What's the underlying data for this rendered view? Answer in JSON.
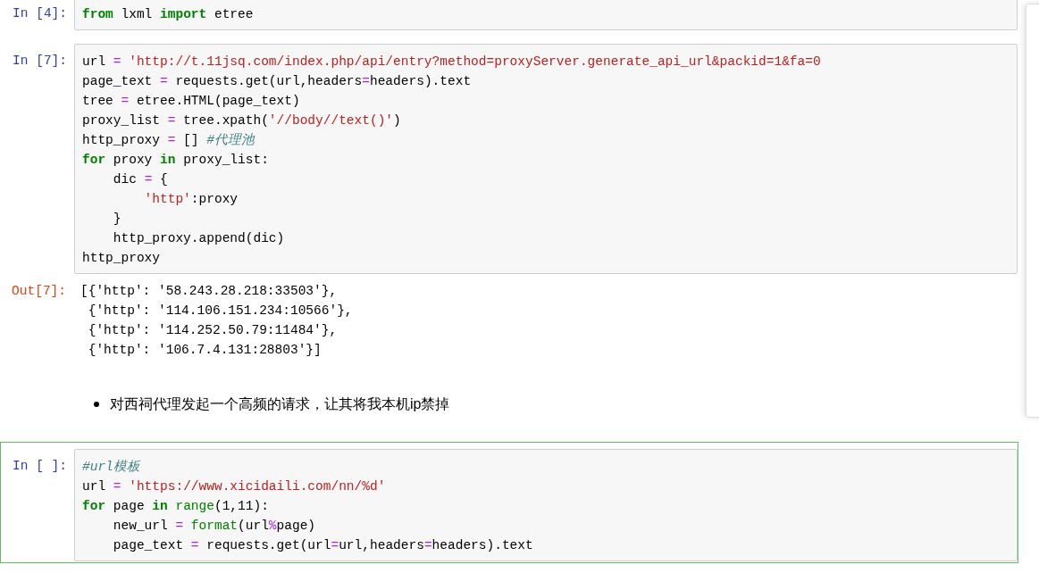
{
  "side_panel": {
    "shown": true
  },
  "cells": [
    {
      "kind": "code",
      "prompt": "In [4]:",
      "selected": false,
      "lines": [
        [
          {
            "kind": "kw",
            "text": "from"
          },
          {
            "kind": "tx",
            "text": " lxml "
          },
          {
            "kind": "kw",
            "text": "import"
          },
          {
            "kind": "tx",
            "text": " etree"
          }
        ]
      ]
    },
    {
      "kind": "code",
      "prompt": "In [7]:",
      "selected": false,
      "lines": [
        [
          {
            "kind": "tx",
            "text": "url "
          },
          {
            "kind": "op",
            "text": "="
          },
          {
            "kind": "str",
            "text": " 'http://t.11jsq.com/index.php/api/entry?method=proxyServer.generate_api_url&packid=1&fa=0"
          }
        ],
        [
          {
            "kind": "tx",
            "text": "page_text "
          },
          {
            "kind": "op",
            "text": "="
          },
          {
            "kind": "tx",
            "text": " requests.get(url,headers"
          },
          {
            "kind": "op",
            "text": "="
          },
          {
            "kind": "tx",
            "text": "headers).text"
          }
        ],
        [
          {
            "kind": "tx",
            "text": "tree "
          },
          {
            "kind": "op",
            "text": "="
          },
          {
            "kind": "tx",
            "text": " etree.HTML(page_text)"
          }
        ],
        [
          {
            "kind": "tx",
            "text": "proxy_list "
          },
          {
            "kind": "op",
            "text": "="
          },
          {
            "kind": "tx",
            "text": " tree.xpath("
          },
          {
            "kind": "str",
            "text": "'//body//text()'"
          },
          {
            "kind": "tx",
            "text": ")"
          }
        ],
        [
          {
            "kind": "tx",
            "text": "http_proxy "
          },
          {
            "kind": "op",
            "text": "="
          },
          {
            "kind": "tx",
            "text": " [] "
          },
          {
            "kind": "cm",
            "text": "#代理池"
          }
        ],
        [
          {
            "kind": "kw",
            "text": "for"
          },
          {
            "kind": "tx",
            "text": " proxy "
          },
          {
            "kind": "kw",
            "text": "in"
          },
          {
            "kind": "tx",
            "text": " proxy_list:"
          }
        ],
        [
          {
            "kind": "tx",
            "text": "    dic "
          },
          {
            "kind": "op",
            "text": "="
          },
          {
            "kind": "tx",
            "text": " {"
          }
        ],
        [
          {
            "kind": "str",
            "text": "        'http'"
          },
          {
            "kind": "tx",
            "text": ":proxy"
          }
        ],
        [
          {
            "kind": "tx",
            "text": "    }"
          }
        ],
        [
          {
            "kind": "tx",
            "text": "    http_proxy.append(dic)"
          }
        ],
        [
          {
            "kind": "tx",
            "text": "http_proxy"
          }
        ]
      ]
    },
    {
      "kind": "output",
      "prompt": "Out[7]:",
      "lines": [
        "[{'http': '58.243.28.218:33503'},",
        " {'http': '114.106.151.234:10566'},",
        " {'http': '114.252.50.79:11484'},",
        " {'http': '106.7.4.131:28803'}]"
      ]
    },
    {
      "kind": "markdown",
      "bullets": [
        "对西祠代理发起一个高频的请求，让其将我本机ip禁掉"
      ]
    },
    {
      "kind": "code",
      "prompt": "In [ ]:",
      "selected": true,
      "lines": [
        [
          {
            "kind": "cm",
            "text": "#url模板"
          }
        ],
        [
          {
            "kind": "tx",
            "text": "url "
          },
          {
            "kind": "op",
            "text": "="
          },
          {
            "kind": "str",
            "text": " 'https://www.xicidaili.com/nn/%d'"
          }
        ],
        [
          {
            "kind": "kw",
            "text": "for"
          },
          {
            "kind": "tx",
            "text": " page "
          },
          {
            "kind": "kw",
            "text": "in"
          },
          {
            "kind": "bi",
            "text": " range"
          },
          {
            "kind": "tx",
            "text": "(1,11):"
          }
        ],
        [
          {
            "kind": "tx",
            "text": "    new_url "
          },
          {
            "kind": "op",
            "text": "="
          },
          {
            "kind": "bi",
            "text": " format"
          },
          {
            "kind": "tx",
            "text": "(url"
          },
          {
            "kind": "op",
            "text": "%"
          },
          {
            "kind": "tx",
            "text": "page)"
          }
        ],
        [
          {
            "kind": "tx",
            "text": "    page_text "
          },
          {
            "kind": "op",
            "text": "="
          },
          {
            "kind": "tx",
            "text": " requests.get(url"
          },
          {
            "kind": "op",
            "text": "="
          },
          {
            "kind": "tx",
            "text": "url,headers"
          },
          {
            "kind": "op",
            "text": "="
          },
          {
            "kind": "tx",
            "text": "headers).text"
          }
        ]
      ]
    }
  ]
}
